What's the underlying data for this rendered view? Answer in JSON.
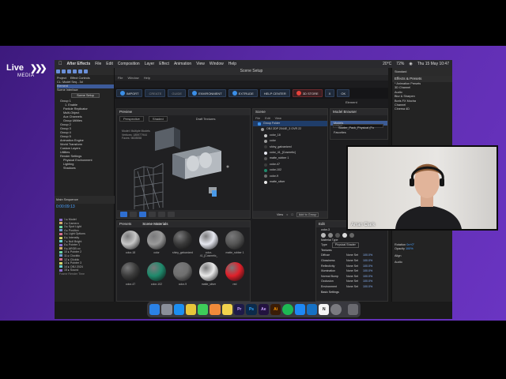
{
  "branding": {
    "logo_line1": "Live",
    "logo_line2": "MEDIA"
  },
  "macos": {
    "menu": [
      "After Effects",
      "File",
      "Edit",
      "Composition",
      "Layer",
      "Effect",
      "Animation",
      "View",
      "Window",
      "Help"
    ],
    "status": {
      "temperature": "20°C",
      "battery": "72%",
      "clock": "Thu 15 May  10:47"
    }
  },
  "ae_left": {
    "project_tab": "Project",
    "effect_controls_tab": "Effect Controls",
    "comp_name": "CL: Model Seq - 3d",
    "layer_name": "Element",
    "scene_setup_btn": "Scene Setup",
    "tree": [
      "Scene Interface",
      "Group 1",
      "1. Enable",
      "Particle Replicator",
      "Multi-Object",
      "Aux Channels",
      "Group Utilities",
      "Group 2",
      "Group 3",
      "Group 4",
      "Group 5",
      "Animation Engine",
      "World Transform",
      "Custom Layers",
      "Utilities",
      "Render Settings",
      "Physical Environment",
      "Lighting",
      "Shadows"
    ],
    "timeline_tab": "Main Sequence",
    "timecode": "0:00:09:13",
    "layers": [
      "1 ▸ Model",
      "2 ▸ Camera",
      "3 ▸ Spot Light",
      "4 ▸ Position",
      "5 ▸ Light Options",
      "6 ▸ Intensity",
      "7 ▸ Null Bright",
      "8 ▸ Pointer 1",
      "9 ▸ ARGB co",
      "10 ▸ Pointer 2",
      "11 ▸ Clocktic",
      "12 ▸ Clicktic",
      "13 ▸ Pointer 3",
      "14 ▸ OBJ 2024",
      "15 ▸ Sound"
    ],
    "footer": "Frame Render Time"
  },
  "scene_setup": {
    "title": "Scene Setup",
    "menu": [
      "File",
      "Window",
      "Help"
    ],
    "toolbar": [
      "IMPORT",
      "CREATE",
      "GUIDE",
      "ENVIRONMENT",
      "EXTRUDE",
      "HELP CENTER",
      "3D STORE",
      "X",
      "OK"
    ],
    "element_label": "Element",
    "preview": {
      "title": "Preview",
      "view_mode": "Perspective",
      "shade_mode": "Shaded",
      "draft": "Draft Textures",
      "stats": [
        "Model:  Multiple Models",
        "Vertices:  185977944",
        "Faces:  9828558"
      ]
    },
    "scene_panel": {
      "title": "Scene",
      "menu": [
        "File",
        "Edit",
        "View"
      ],
      "group": "Group Folder",
      "items": [
        "OBJ 2DP 2044E_3 OVR 22",
        "color_18",
        "color",
        "shiny_galvanized",
        "color_41_[Cosmetic]",
        "matte_rubber 1",
        "color-47",
        "color-102",
        "color-9",
        "matte_silver"
      ],
      "view_label": "View",
      "add_group": "Add to Group"
    },
    "model_browser": {
      "title": "Model Browser",
      "search_placeholder": "Search...",
      "items": [
        "Models",
        "Starter_Pack_Physical (Fo",
        "Favorites"
      ]
    },
    "presets": {
      "tabs": [
        "Presets",
        "Scene Materials"
      ],
      "materials": [
        {
          "name": "color-18",
          "color": "#c8c8c8"
        },
        {
          "name": "color",
          "color": "#9a9a9a"
        },
        {
          "name": "shiny_galvanized",
          "color": "#3a3a3a"
        },
        {
          "name": "color-41_[Cosmetic_",
          "color": "#e6e8f0"
        },
        {
          "name": "matte_rubber 1",
          "color": "#555555"
        },
        {
          "name": "color-47",
          "color": "#3c3c3c"
        },
        {
          "name": "color-102",
          "color": "#1f8a6c"
        },
        {
          "name": "color-9",
          "color": "#6f6f6f"
        },
        {
          "name": "matte_silver",
          "color": "#e9e9e9"
        },
        {
          "name": "red",
          "color": "#e0202a"
        }
      ]
    },
    "edit_panel": {
      "title": "Edit",
      "material_name": "color-3",
      "material_type_label": "Material Type",
      "type_label": "Type",
      "type_value": "Physical Shader",
      "textures_label": "Textures",
      "rows": [
        {
          "name": "Diffuse",
          "set": "None Set",
          "val": "100.0%"
        },
        {
          "name": "Glossiness",
          "set": "None Set",
          "val": "100.0%"
        },
        {
          "name": "Reflectivity",
          "set": "None Set",
          "val": "100.0%"
        },
        {
          "name": "Illumination",
          "set": "None Set",
          "val": "100.0%"
        },
        {
          "name": "Normal Bump",
          "set": "None Set",
          "val": "100.0%"
        },
        {
          "name": "Occlusion",
          "set": "None Set",
          "val": "100.0%"
        },
        {
          "name": "Environment",
          "set": "None Set",
          "val": "100.0%"
        }
      ],
      "basic_settings": "Basic Settings"
    }
  },
  "ae_right": {
    "workspace": "Standard",
    "effects_presets": "Effects & Presets",
    "list": [
      "* Animation Presets",
      "3D Channel",
      "Audio",
      "Blur & Sharpen",
      "Boris FX Mocha",
      "Channel",
      "Cinema 4D"
    ],
    "rotation_label": "Rotation",
    "rotation_value": "0x+0°",
    "opacity_label": "Opacity",
    "opacity_value": "100%",
    "align_label": "Align",
    "audio_label": "Audio"
  },
  "dock": {
    "apps": [
      {
        "name": "Finder",
        "color": "#2b82e6",
        "label": ""
      },
      {
        "name": "Launchpad",
        "color": "#8a8f9a",
        "label": ""
      },
      {
        "name": "Safari",
        "color": "#1c8ef0",
        "label": ""
      },
      {
        "name": "Chrome",
        "color": "#e8c53a",
        "label": ""
      },
      {
        "name": "Messages",
        "color": "#3ecc5a",
        "label": ""
      },
      {
        "name": "Photos",
        "color": "#f08a3a",
        "label": ""
      },
      {
        "name": "Notes",
        "color": "#f2d34d",
        "label": ""
      },
      {
        "name": "Premiere",
        "color": "#1e1a48",
        "label": "Pr"
      },
      {
        "name": "Photoshop",
        "color": "#0c2a4a",
        "label": "Ps"
      },
      {
        "name": "After Effects",
        "color": "#22123f",
        "label": "Ae"
      },
      {
        "name": "Illustrator",
        "color": "#3a1c07",
        "label": "Ai"
      },
      {
        "name": "Spotify",
        "color": "#1db954",
        "label": ""
      },
      {
        "name": "App Store",
        "color": "#1e88f5",
        "label": ""
      },
      {
        "name": "VS Code",
        "color": "#1671c4",
        "label": ""
      },
      {
        "name": "Notion",
        "color": "#f4f4f4",
        "label": "N"
      },
      {
        "name": "Settings",
        "color": "#7a7a80",
        "label": ""
      },
      {
        "name": "Trash",
        "color": "#6a6a70",
        "label": ""
      }
    ]
  },
  "webcam": {
    "name": "Arran Clark"
  },
  "colors": {
    "band": "#5a2aa8",
    "accent": "#3b8fe8"
  }
}
